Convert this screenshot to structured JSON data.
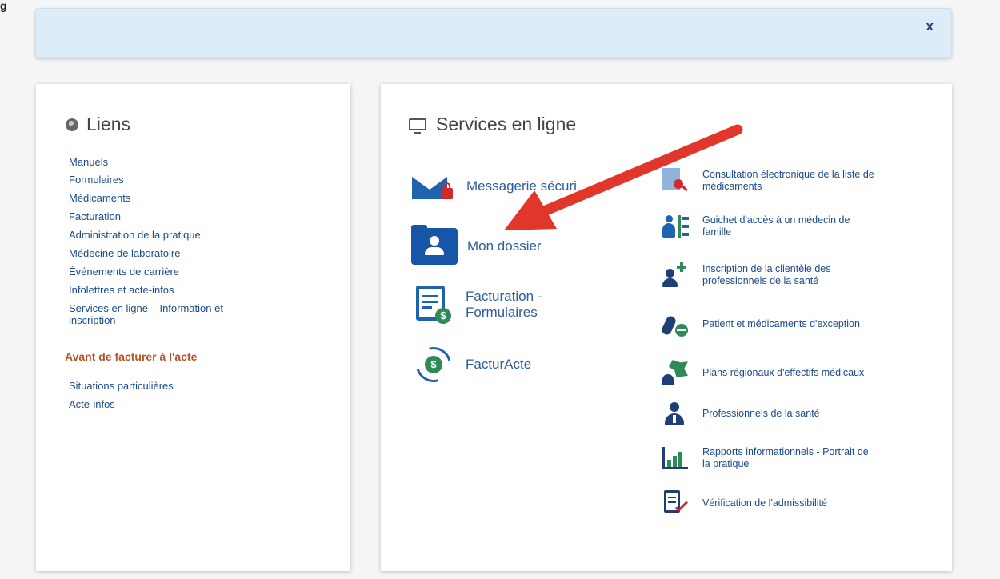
{
  "page_fragment": "g",
  "banner": {
    "close_label": "x"
  },
  "liens": {
    "title": "Liens",
    "links": [
      "Manuels",
      "Formulaires",
      "Médicaments",
      "Facturation",
      "Administration de la pratique",
      "Médecine de laboratoire",
      "Événements de carrière",
      "Infolettres et acte-infos",
      "Services en ligne – Information et inscription"
    ],
    "subheading": "Avant de facturer à l'acte",
    "sub_links": [
      "Situations particulières",
      "Acte-infos"
    ]
  },
  "services": {
    "title": "Services en ligne",
    "main_items": [
      {
        "label": "Messagerie sécuri",
        "icon": "envelope-lock-icon"
      },
      {
        "label": "Mon dossier",
        "icon": "folder-user-icon"
      },
      {
        "label": "Facturation - Formulaires",
        "icon": "document-dollar-icon"
      },
      {
        "label": "FacturActe",
        "icon": "cycle-dollar-icon"
      }
    ],
    "side_items": [
      {
        "label": "Consultation électronique de la liste de médicaments",
        "icon": "document-search-icon"
      },
      {
        "label": "Guichet d'accès à un médecin de famille",
        "icon": "family-doctor-icon"
      },
      {
        "label": "Inscription de la clientèle des professionnels de la santé",
        "icon": "user-add-icon"
      },
      {
        "label": "Patient et médicaments d'exception",
        "icon": "capsule-icon"
      },
      {
        "label": "Plans régionaux d'effectifs médicaux",
        "icon": "region-map-icon"
      },
      {
        "label": "Professionnels de la santé",
        "icon": "doctor-icon"
      },
      {
        "label": "Rapports informationnels - Portrait de la pratique",
        "icon": "report-chart-icon"
      },
      {
        "label": "Vérification de l'admissibilité",
        "icon": "checklist-icon"
      }
    ]
  },
  "colors": {
    "accent_blue": "#1f63b0",
    "link_blue": "#1a4a8b",
    "annotation_red": "#e0362c",
    "subheading_orange": "#b4552b",
    "banner_bg": "#dcecf8"
  }
}
